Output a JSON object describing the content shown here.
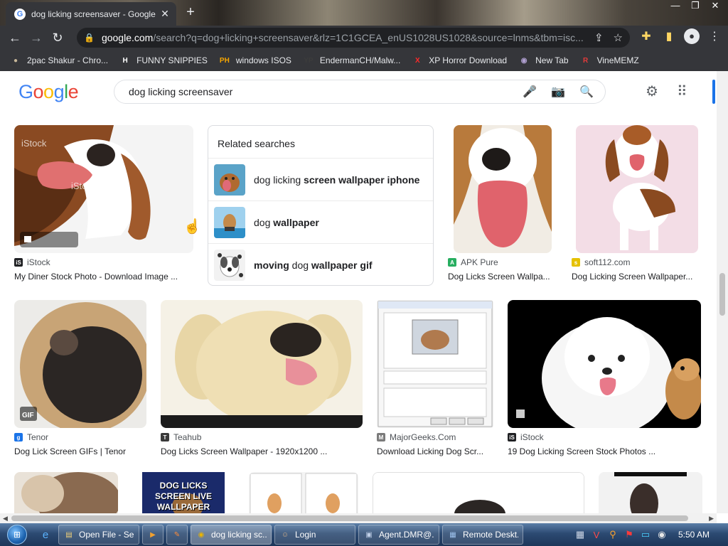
{
  "browser": {
    "tab_title": "dog licking screensaver - Google",
    "new_tab_symbol": "+",
    "url_domain": "google.com",
    "url_rest": "/search?q=dog+licking+screensaver&rlz=1C1GCEA_enUS1028US1028&source=lnms&tbm=isc...",
    "bookmarks": [
      {
        "label": "2pac Shakur - Chro...",
        "icon": "2pac-icon",
        "glyph": "●",
        "color": "#c8b89a"
      },
      {
        "label": "FUNNY SNIPPIES",
        "icon": "h-letter-icon",
        "glyph": "H",
        "color": "#ffffff"
      },
      {
        "label": "windows ISOS",
        "icon": "ph-icon",
        "glyph": "PH",
        "color": "#f7a600"
      },
      {
        "label": "EndermanCH/Malw...",
        "icon": "yp-icon",
        "glyph": "YP",
        "color": "#3c3c3c"
      },
      {
        "label": "XP Horror Download",
        "icon": "x-icon",
        "glyph": "X",
        "color": "#ff2a2a"
      },
      {
        "label": "New Tab",
        "icon": "globe-icon",
        "glyph": "◉",
        "color": "#b0a0d0"
      },
      {
        "label": "VineMEMZ",
        "icon": "r-icon",
        "glyph": "R",
        "color": "#e23b3b"
      }
    ]
  },
  "google": {
    "logo": [
      {
        "ch": "G",
        "color": "#4285F4"
      },
      {
        "ch": "o",
        "color": "#EA4335"
      },
      {
        "ch": "o",
        "color": "#FBBC05"
      },
      {
        "ch": "g",
        "color": "#4285F4"
      },
      {
        "ch": "l",
        "color": "#34A853"
      },
      {
        "ch": "e",
        "color": "#EA4335"
      }
    ],
    "query": "dog licking screensaver"
  },
  "results": {
    "related_title": "Related searches",
    "related": [
      {
        "pre": "dog licking ",
        "bold": "screen wallpaper iphone",
        "post": ""
      },
      {
        "pre": "dog ",
        "bold": "wallpaper",
        "post": ""
      },
      {
        "pre": "",
        "bold": "moving",
        "post": " dog ",
        "bold2": "wallpaper gif"
      }
    ],
    "cards": [
      {
        "source": "iStock",
        "caption": "My Diner Stock Photo - Download Image ...",
        "fav": "iS",
        "favcolor": "#202124"
      },
      {
        "source": "APK Pure",
        "caption": "Dog Licks Screen Wallpa...",
        "fav": "A",
        "favcolor": "#27ae60"
      },
      {
        "source": "soft112.com",
        "caption": "Dog Licking Screen Wallpaper...",
        "fav": "s",
        "favcolor": "#e5c100"
      },
      {
        "source": "Tenor",
        "caption": "Dog Lick Screen GIFs | Tenor",
        "fav": "gif",
        "favcolor": "#1a73e8",
        "badge": "GIF"
      },
      {
        "source": "Teahub",
        "caption": "Dog Licks Screen Wallpaper - 1920x1200 ...",
        "fav": "T",
        "favcolor": "#3a3a3a"
      },
      {
        "source": "MajorGeeks.Com",
        "caption": "Download Licking Dog Scr...",
        "fav": "M",
        "favcolor": "#7b7b7b"
      },
      {
        "source": "iStock",
        "caption": "19 Dog Licking Screen Stock Photos ...",
        "fav": "iS",
        "favcolor": "#202124"
      }
    ],
    "thumb_text": "DOG LICKS SCREEN LIVE WALLPAPER"
  },
  "taskbar": {
    "buttons": [
      {
        "label": "Open File - Se...",
        "icon": "folder-icon",
        "glyph": "▤",
        "color": "#f3d27a"
      },
      {
        "label": "",
        "icon": "media-icon",
        "glyph": "▶",
        "color": "#f0a030"
      },
      {
        "label": "",
        "icon": "paint-icon",
        "glyph": "✎",
        "color": "#ff8c3a"
      },
      {
        "label": "dog licking sc...",
        "icon": "chrome-icon",
        "glyph": "◉",
        "color": "#e9b400",
        "active": true
      },
      {
        "label": "Login",
        "icon": "login-icon",
        "glyph": "☺",
        "color": "#d8b38a"
      },
      {
        "label": "Agent.DMR@...",
        "icon": "agent-icon",
        "glyph": "▣",
        "color": "#c0d0e8"
      },
      {
        "label": "Remote Deskt...",
        "icon": "remote-desktop-icon",
        "glyph": "▦",
        "color": "#9fc3ee"
      }
    ],
    "clock": "5:50 AM"
  }
}
